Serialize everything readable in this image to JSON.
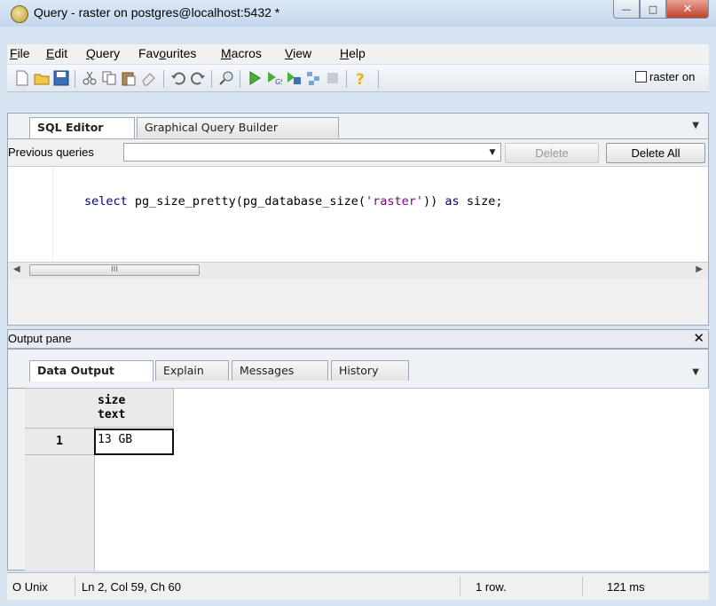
{
  "window": {
    "title": "Query - raster on postgres@localhost:5432 *",
    "minimize": "—",
    "maximize": "□",
    "close": "✕"
  },
  "menu": {
    "file_pre": "",
    "file_ul": "F",
    "file_post": "ile",
    "edit_pre": "",
    "edit_ul": "E",
    "edit_post": "dit",
    "query_pre": "",
    "query_ul": "Q",
    "query_post": "uery",
    "fav_pre": "Fav",
    "fav_ul": "o",
    "fav_post": "urites",
    "macros_pre": "",
    "macros_ul": "M",
    "macros_post": "acros",
    "view_pre": "",
    "view_ul": "V",
    "view_post": "iew",
    "help_pre": "",
    "help_ul": "H",
    "help_post": "elp"
  },
  "toolbar": {
    "db_checkbox_label": "raster on",
    "icons": [
      "new-icon",
      "open-icon",
      "save-icon",
      "cut-icon",
      "copy-icon",
      "paste-icon",
      "clear-icon",
      "undo-icon",
      "redo-icon",
      "find-icon",
      "execute-icon",
      "execute-pgscript-icon",
      "execute-to-file-icon",
      "explain-icon",
      "cancel-icon",
      "help-icon"
    ]
  },
  "editor": {
    "tabs": [
      "SQL Editor",
      "Graphical Query Builder"
    ],
    "previous_queries_label": "Previous queries",
    "previous_queries_value": "",
    "delete_label": "Delete",
    "delete_all_label": "Delete All",
    "code": {
      "kw_select": "select",
      "fn": " pg_size_pretty(pg_database_size(",
      "str": "'raster'",
      "close": ")) ",
      "kw_as": "as",
      "tail": " size;"
    },
    "scroll_thumb": "III"
  },
  "output": {
    "title": "Output pane",
    "close": "✕",
    "tabs": [
      "Data Output",
      "Explain",
      "Messages",
      "History"
    ],
    "column_name": "size",
    "column_type": "text",
    "rows": [
      {
        "num": "1",
        "size": "13 GB"
      }
    ]
  },
  "status": {
    "line_ending": "O Unix",
    "position": "Ln 2, Col 59, Ch 60",
    "row_count": "1 row.",
    "duration": "121 ms"
  }
}
